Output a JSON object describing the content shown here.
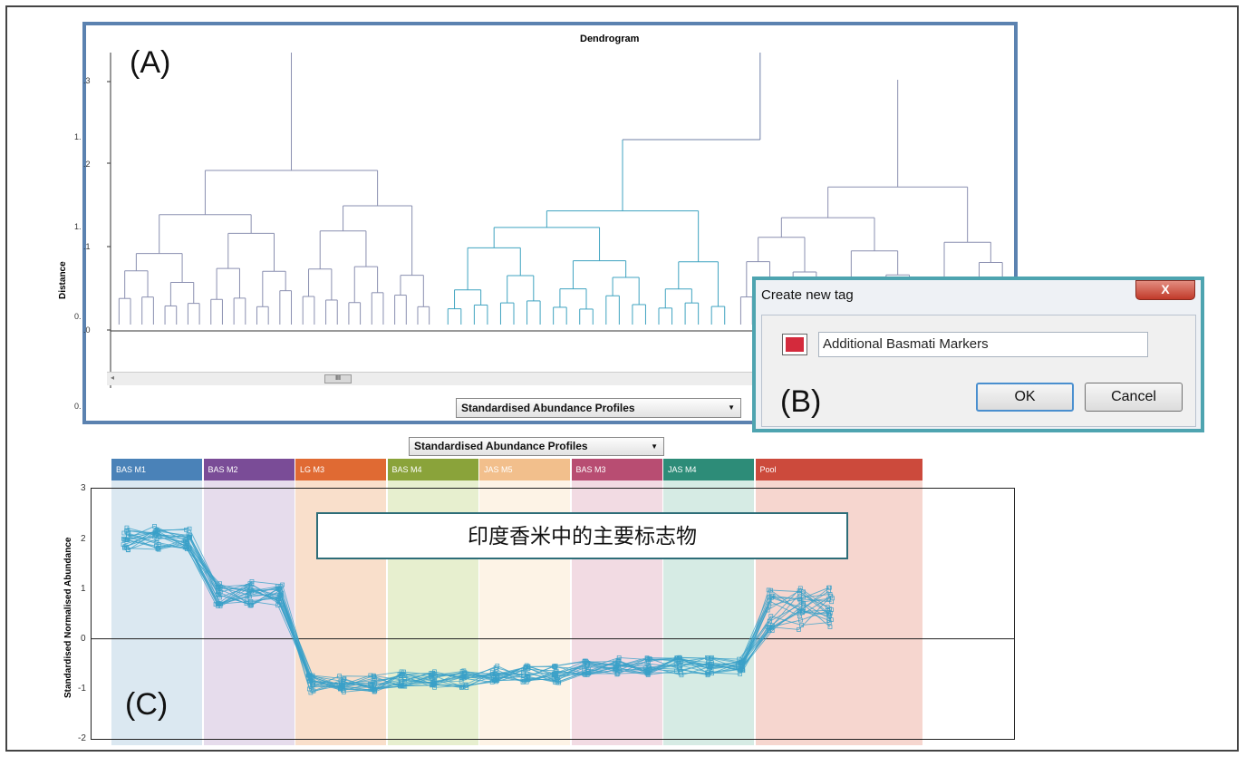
{
  "panel_a": {
    "label": "(A)",
    "title": "Dendrogram",
    "y_axis_label": "Distance",
    "tick_labels": [
      ".3",
      "1.",
      ".2",
      "1.",
      ".1",
      "0.",
      ".0",
      "0."
    ],
    "scroll_thumb": "III",
    "dropdown": "Standardised Abundance Profiles"
  },
  "panel_b": {
    "label": "(B)",
    "title": "Create new tag",
    "close": "X",
    "tag_color": "#d42a3c",
    "tag_name": "Additional Basmati Markers",
    "ok": "OK",
    "cancel": "Cancel"
  },
  "panel_c": {
    "label": "(C)",
    "dropdown": "Standardised Abundance Profiles",
    "callout": "印度香米中的主要标志物",
    "y_axis_label": "Standardised Normalised Abundance",
    "y_ticks": [
      "3",
      "2",
      "1",
      "0",
      "-1",
      "-2"
    ],
    "groups": [
      {
        "name": "BAS M1",
        "color": "#4a82b8",
        "bg": "#dbe8f1"
      },
      {
        "name": "BAS M2",
        "color": "#7a4c97",
        "bg": "#e6dcec"
      },
      {
        "name": "LG M3",
        "color": "#e06a33",
        "bg": "#f9dfcb"
      },
      {
        "name": "BAS M4",
        "color": "#8aa33a",
        "bg": "#e7efcf"
      },
      {
        "name": "JAS M5",
        "color": "#f2bf8c",
        "bg": "#fdf3e6"
      },
      {
        "name": "BAS M3",
        "color": "#b84d72",
        "bg": "#f2dbe3"
      },
      {
        "name": "JAS M4",
        "color": "#2d8c78",
        "bg": "#d6ebe4"
      },
      {
        "name": "Pool",
        "color": "#cc4a3c",
        "bg": "#f6d6cf"
      }
    ]
  },
  "chart_data": {
    "type": "line",
    "title": "",
    "ylabel": "Standardised Normalised Abundance",
    "ylim": [
      -2,
      3
    ],
    "groups": [
      "BAS M1",
      "BAS M2",
      "LG M3",
      "BAS M4",
      "JAS M5",
      "BAS M3",
      "JAS M4",
      "Pool"
    ],
    "group_means": [
      2.0,
      0.9,
      -0.9,
      -0.8,
      -0.7,
      -0.55,
      -0.55,
      0.6
    ],
    "series_count": 20
  }
}
